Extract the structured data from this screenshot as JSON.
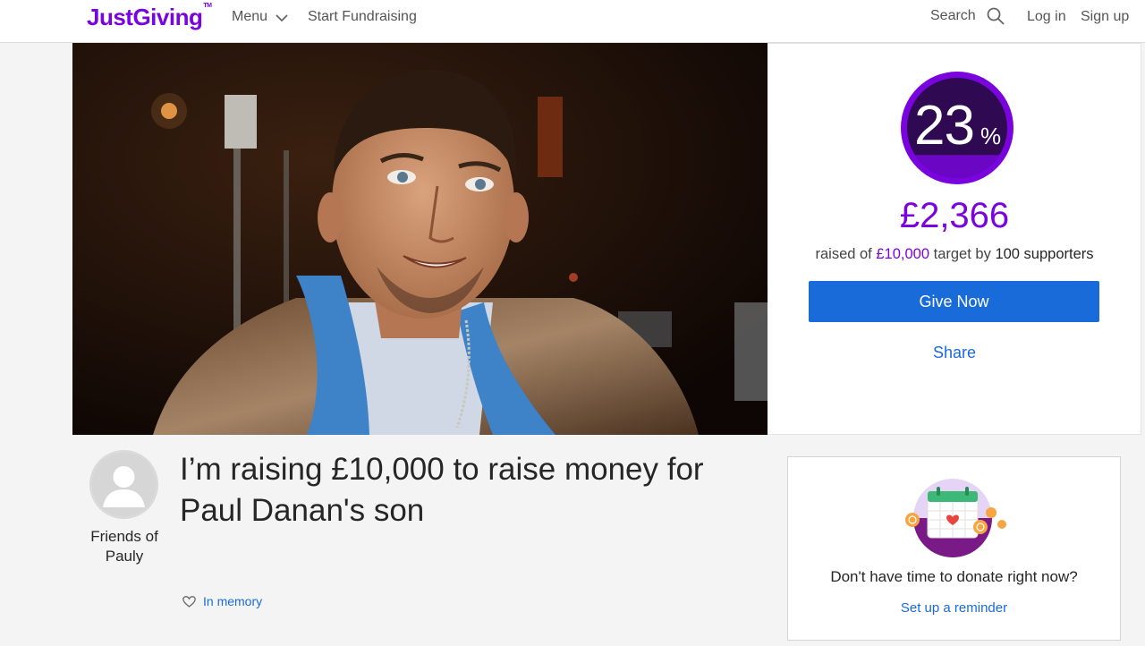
{
  "header": {
    "logo": "JustGiving",
    "logo_tm": "TM",
    "menu_label": "Menu",
    "start_fundraising": "Start Fundraising",
    "search_label": "Search",
    "login": "Log in",
    "signup": "Sign up"
  },
  "fundraiser": {
    "progress_percent": "23",
    "percent_sign": "%",
    "progress_fraction": 0.23,
    "raised_amount": "£2,366",
    "raised_prefix": "raised of",
    "target": "£10,000",
    "target_suffix": "target by",
    "supporters": "100 supporters",
    "give_now": "Give Now",
    "share": "Share"
  },
  "page": {
    "title": "I’m raising £10,000 to raise money for Paul Danan's son",
    "owner_name": "Friends of Pauly",
    "tag": "In memory"
  },
  "reminder": {
    "prompt": "Don't have time to donate right now?",
    "link": "Set up a reminder"
  },
  "colors": {
    "brand": "#7a04dd",
    "button": "#1a6bda",
    "link": "#1a6bda"
  }
}
